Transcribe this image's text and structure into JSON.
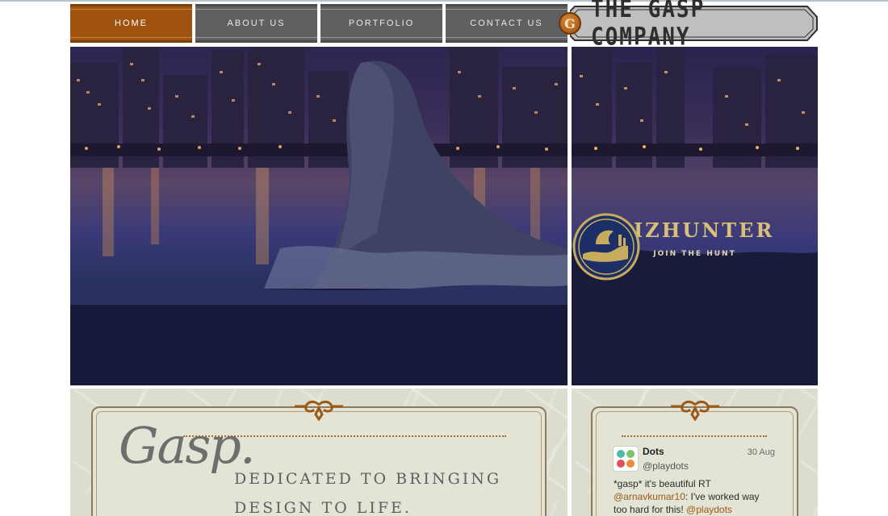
{
  "nav": {
    "items": [
      {
        "label": "HOME",
        "active": true
      },
      {
        "label": "ABOUT US",
        "active": false
      },
      {
        "label": "PORTFOLIO",
        "active": false
      },
      {
        "label": "CONTACT US",
        "active": false
      }
    ]
  },
  "brand": {
    "emblem_letter": "G",
    "name": "THE GASP COMPANY"
  },
  "hero": {
    "feature_brand": "BIZHUNTER",
    "feature_tagline": "JOIN THE HUNT"
  },
  "intro": {
    "script_word": "Gasp.",
    "tagline": "DEDICATED TO BRINGING DESIGN TO LIFE."
  },
  "tweet": {
    "name": "Dots",
    "handle": "@playdots",
    "date": "30 Aug",
    "text_before": "*gasp* it's beautiful RT ",
    "mention": "@arnavkumar10",
    "text_middle": ": I've worked way too hard for this! ",
    "mention2": "@playdots"
  },
  "colors": {
    "accent": "#a0530f",
    "nav_gray": "#5f6061",
    "panel": "#dcddcf",
    "gold": "#d6c07a"
  }
}
